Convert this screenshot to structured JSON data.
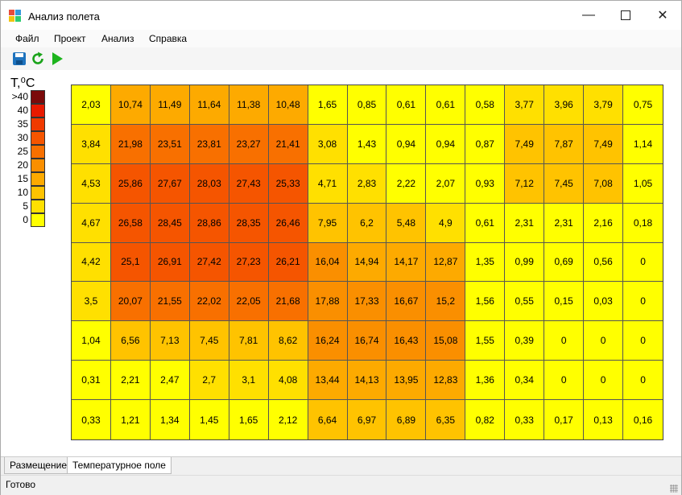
{
  "window": {
    "title": "Анализ полета"
  },
  "menu": [
    "Файл",
    "Проект",
    "Анализ",
    "Справка"
  ],
  "toolbar": {
    "icons": [
      "save-icon",
      "refresh-icon",
      "run-icon"
    ]
  },
  "legend": {
    "unit_label": "T,⁰C",
    "entries": [
      {
        "label": ">40",
        "color": "#7b0a0a"
      },
      {
        "label": "40",
        "color": "#e81a00"
      },
      {
        "label": "35",
        "color": "#f03a00"
      },
      {
        "label": "30",
        "color": "#f55500"
      },
      {
        "label": "25",
        "color": "#f87000"
      },
      {
        "label": "20",
        "color": "#fa8f00"
      },
      {
        "label": "15",
        "color": "#fdaa00"
      },
      {
        "label": "10",
        "color": "#ffc300"
      },
      {
        "label": "5",
        "color": "#ffe000"
      },
      {
        "label": "0",
        "color": "#ffff00"
      }
    ]
  },
  "chart_data": {
    "type": "heatmap",
    "unit": "T,⁰C",
    "rows": [
      [
        "2,03",
        "10,74",
        "11,49",
        "11,64",
        "11,38",
        "10,48",
        "1,65",
        "0,85",
        "0,61",
        "0,61",
        "0,58",
        "3,77",
        "3,96",
        "3,79",
        "0,75"
      ],
      [
        "3,84",
        "21,98",
        "23,51",
        "23,81",
        "23,27",
        "21,41",
        "3,08",
        "1,43",
        "0,94",
        "0,94",
        "0,87",
        "7,49",
        "7,87",
        "7,49",
        "1,14"
      ],
      [
        "4,53",
        "25,86",
        "27,67",
        "28,03",
        "27,43",
        "25,33",
        "4,71",
        "2,83",
        "2,22",
        "2,07",
        "0,93",
        "7,12",
        "7,45",
        "7,08",
        "1,05"
      ],
      [
        "4,67",
        "26,58",
        "28,45",
        "28,86",
        "28,35",
        "26,46",
        "7,95",
        "6,2",
        "5,48",
        "4,9",
        "0,61",
        "2,31",
        "2,31",
        "2,16",
        "0,18"
      ],
      [
        "4,42",
        "25,1",
        "26,91",
        "27,42",
        "27,23",
        "26,21",
        "16,04",
        "14,94",
        "14,17",
        "12,87",
        "1,35",
        "0,99",
        "0,69",
        "0,56",
        "0"
      ],
      [
        "3,5",
        "20,07",
        "21,55",
        "22,02",
        "22,05",
        "21,68",
        "17,88",
        "17,33",
        "16,67",
        "15,2",
        "1,56",
        "0,55",
        "0,15",
        "0,03",
        "0"
      ],
      [
        "1,04",
        "6,56",
        "7,13",
        "7,45",
        "7,81",
        "8,62",
        "16,24",
        "16,74",
        "16,43",
        "15,08",
        "1,55",
        "0,39",
        "0",
        "0",
        "0"
      ],
      [
        "0,31",
        "2,21",
        "2,47",
        "2,7",
        "3,1",
        "4,08",
        "13,44",
        "14,13",
        "13,95",
        "12,83",
        "1,36",
        "0,34",
        "0",
        "0",
        "0"
      ],
      [
        "0,33",
        "1,21",
        "1,34",
        "1,45",
        "1,65",
        "2,12",
        "6,64",
        "6,97",
        "6,89",
        "6,35",
        "0,82",
        "0,33",
        "0,17",
        "0,13",
        "0,16"
      ]
    ]
  },
  "tabs": [
    {
      "label": "Размещение",
      "active": false
    },
    {
      "label": "Температурное поле",
      "active": true
    }
  ],
  "status": {
    "text": "Готово"
  }
}
